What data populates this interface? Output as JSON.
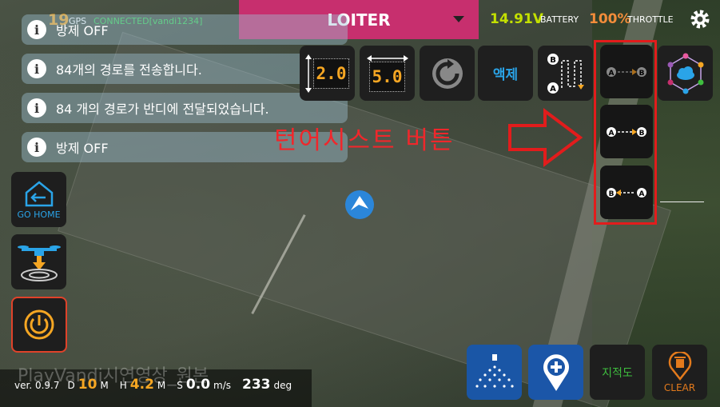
{
  "header": {
    "gps_count": "19",
    "gps_label": "GPS",
    "connection": "CONNECTED[vandi1234]",
    "flight_mode": "LOITER",
    "battery_voltage": "14.91V",
    "battery_label": "BATTERY",
    "throttle_value": "100%",
    "throttle_label": "THROTTLE"
  },
  "messages": [
    {
      "text": "방제 OFF"
    },
    {
      "text": "84개의 경로를 전송합니다."
    },
    {
      "text": "84 개의 경로가 반디에 전달되었습니다."
    },
    {
      "text": "방제 OFF"
    }
  ],
  "toolbar": {
    "height_value": "2.0",
    "spacing_value": "5.0",
    "liquid_label": "액제"
  },
  "side": {
    "go_home_label": "GO HOME"
  },
  "annotation": {
    "text": "턴어시스트 버튼",
    "color": "#e21c1c"
  },
  "watermark": "PlayVandi시연영상_원본",
  "status": {
    "version": "ver. 0.9.7",
    "d_label": "D",
    "d_value": "10",
    "d_unit": "M",
    "h_label": "H",
    "h_value": "4.2",
    "h_unit": "M",
    "s_label": "S",
    "s_value": "0.0",
    "s_unit": "m/s",
    "heading_value": "233",
    "heading_unit": "deg"
  },
  "bottom_buttons": {
    "map_label": "지적도",
    "clear_label": "CLEAR"
  },
  "colors": {
    "mode_bar": "#c72f6e",
    "accent_orange": "#f5a623",
    "connected_green": "#39d353",
    "battery_green": "#c3e000",
    "annotation_red": "#e21c1c"
  }
}
